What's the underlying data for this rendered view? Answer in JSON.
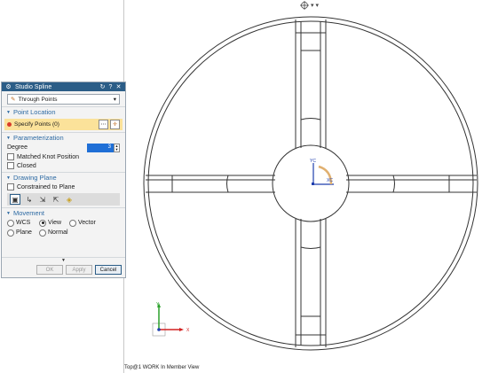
{
  "toolbar": {
    "orient_icon": "crosshair-orient-icon",
    "dropdown_glyph": "▾"
  },
  "dialog": {
    "title": "Studio Spline",
    "title_icons": [
      "reset-icon",
      "help-icon",
      "close-icon"
    ],
    "type_select": "Through Points",
    "sections": {
      "point_location": "Point Location",
      "parameterization": "Parameterization",
      "drawing_plane": "Drawing Plane",
      "movement": "Movement"
    },
    "specify_points": "Specify Points (0)",
    "degree_label": "Degree",
    "degree_value": "3",
    "matched_knot": "Matched Knot Position",
    "closed": "Closed",
    "constrained": "Constrained to Plane",
    "movement_options": {
      "wcs": "WCS",
      "view": "View",
      "vector": "Vector",
      "plane": "Plane",
      "normal": "Normal"
    },
    "buttons": {
      "ok": "OK",
      "apply": "Apply",
      "cancel": "Cancel"
    }
  },
  "viewport": {
    "axis_labels": {
      "yc": "YC",
      "xc": "XC",
      "y": "Y",
      "x": "X"
    },
    "colors": {
      "y_axis": "#2aa12a",
      "x_axis": "#d22020",
      "z_dot": "#1f3fae",
      "arc": "#e0b070"
    }
  },
  "status_bar": {
    "text": "Top@1 WORK In Member View"
  }
}
